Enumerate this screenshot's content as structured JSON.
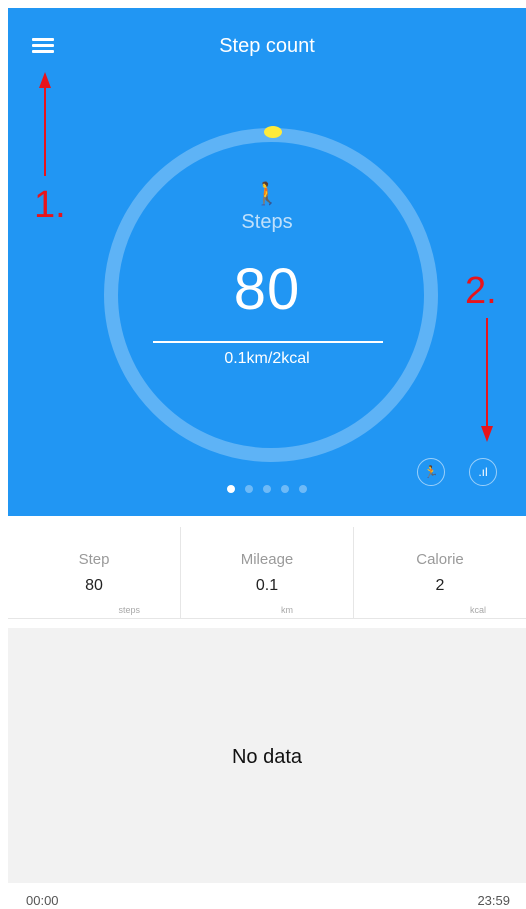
{
  "header": {
    "title": "Step count",
    "menu_icon": "hamburger-menu-icon"
  },
  "colors": {
    "primary": "#2196f3",
    "ring_progress": "#ffeb3b",
    "annotation": "#e8141b",
    "panel_bg": "#f2f2f2"
  },
  "ring": {
    "progress_fraction": 0.0,
    "walker_icon": "walking-person-icon",
    "walker_glyph": "🚶"
  },
  "main_metric": {
    "label": "Steps",
    "value": "80",
    "summary": "0.1km/2kcal"
  },
  "actions": {
    "run": {
      "icon": "running-icon",
      "glyph": "🏃"
    },
    "stats": {
      "icon": "bar-chart-icon",
      "glyph": ".ıl"
    }
  },
  "pager": {
    "count": 5,
    "active": 0
  },
  "annotations": [
    {
      "label": "1."
    },
    {
      "label": "2."
    }
  ],
  "stats": [
    {
      "label": "Step",
      "value": "80",
      "unit": "steps"
    },
    {
      "label": "Mileage",
      "value": "0.1",
      "unit": "km"
    },
    {
      "label": "Calorie",
      "value": "2",
      "unit": "kcal"
    }
  ],
  "chart_panel": {
    "message": "No data"
  },
  "time_axis": {
    "start": "00:00",
    "end": "23:59"
  }
}
